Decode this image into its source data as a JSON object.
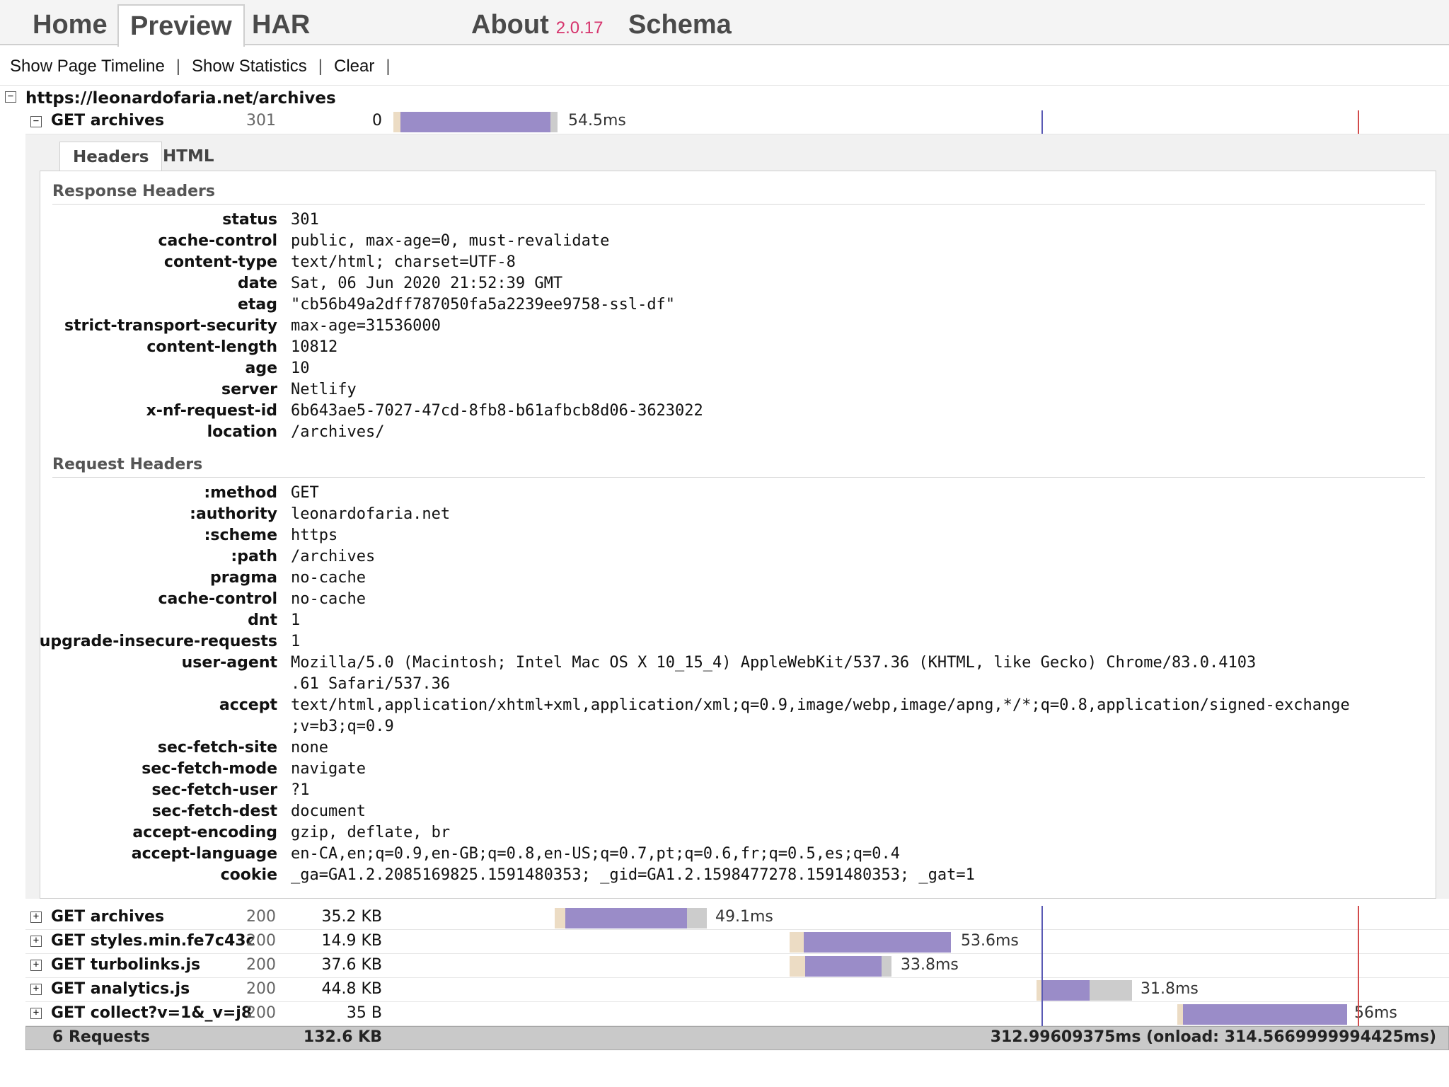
{
  "nav": {
    "home": "Home",
    "preview": "Preview",
    "har": "HAR",
    "about": "About",
    "version": "2.0.17",
    "schema": "Schema"
  },
  "toolbar": {
    "timeline": "Show Page Timeline",
    "statistics": "Show Statistics",
    "clear": "Clear",
    "sep": "|"
  },
  "page": {
    "url": "https://leonardofaria.net/archives",
    "toggle_open": "−",
    "toggle_closed": "+"
  },
  "first_entry": {
    "name": "GET archives",
    "status": "301",
    "size": "0",
    "time": "54.5ms"
  },
  "detail_tabs": {
    "headers": "Headers",
    "html": "HTML"
  },
  "response_headers": {
    "title": "Response Headers",
    "rows": [
      {
        "key": "status",
        "value": "301"
      },
      {
        "key": "cache-control",
        "value": "public, max-age=0, must-revalidate"
      },
      {
        "key": "content-type",
        "value": "text/html; charset=UTF-8"
      },
      {
        "key": "date",
        "value": "Sat, 06 Jun 2020 21:52:39 GMT"
      },
      {
        "key": "etag",
        "value": "\"cb56b49a2dff787050fa5a2239ee9758-ssl-df\""
      },
      {
        "key": "strict-transport-security",
        "value": "max-age=31536000"
      },
      {
        "key": "content-length",
        "value": "10812"
      },
      {
        "key": "age",
        "value": "10"
      },
      {
        "key": "server",
        "value": "Netlify"
      },
      {
        "key": "x-nf-request-id",
        "value": "6b643ae5-7027-47cd-8fb8-b61afbcb8d06-3623022"
      },
      {
        "key": "location",
        "value": "/archives/"
      }
    ]
  },
  "request_headers": {
    "title": "Request Headers",
    "rows": [
      {
        "key": ":method",
        "value": "GET"
      },
      {
        "key": ":authority",
        "value": "leonardofaria.net"
      },
      {
        "key": ":scheme",
        "value": "https"
      },
      {
        "key": ":path",
        "value": "/archives"
      },
      {
        "key": "pragma",
        "value": "no-cache"
      },
      {
        "key": "cache-control",
        "value": "no-cache"
      },
      {
        "key": "dnt",
        "value": "1"
      },
      {
        "key": "upgrade-insecure-requests",
        "value": "1"
      },
      {
        "key": "user-agent",
        "value": "Mozilla/5.0 (Macintosh; Intel Mac OS X 10_15_4) AppleWebKit/537.36 (KHTML, like Gecko) Chrome/83.0.4103\n.61 Safari/537.36"
      },
      {
        "key": "accept",
        "value": "text/html,application/xhtml+xml,application/xml;q=0.9,image/webp,image/apng,*/*;q=0.8,application/signed-exchange\n;v=b3;q=0.9"
      },
      {
        "key": "sec-fetch-site",
        "value": "none"
      },
      {
        "key": "sec-fetch-mode",
        "value": "navigate"
      },
      {
        "key": "sec-fetch-user",
        "value": "?1"
      },
      {
        "key": "sec-fetch-dest",
        "value": "document"
      },
      {
        "key": "accept-encoding",
        "value": "gzip, deflate, br"
      },
      {
        "key": "accept-language",
        "value": "en-CA,en;q=0.9,en-GB;q=0.8,en-US;q=0.7,pt;q=0.6,fr;q=0.5,es;q=0.4"
      },
      {
        "key": "cookie",
        "value": "_ga=GA1.2.2085169825.1591480353; _gid=GA1.2.1598477278.1591480353; _gat=1"
      }
    ]
  },
  "entries": [
    {
      "name": "GET archives",
      "status": "200",
      "size": "35.2 KB",
      "time": "49.1ms"
    },
    {
      "name": "GET styles.min.fe7c43c",
      "status": "200",
      "size": "14.9 KB",
      "time": "53.6ms"
    },
    {
      "name": "GET turbolinks.js",
      "status": "200",
      "size": "37.6 KB",
      "time": "33.8ms"
    },
    {
      "name": "GET analytics.js",
      "status": "200",
      "size": "44.8 KB",
      "time": "31.8ms"
    },
    {
      "name": "GET collect?v=1&_v=j8",
      "status": "200",
      "size": "35 B",
      "time": "56ms"
    }
  ],
  "footer": {
    "requests": "6 Requests",
    "total_size": "132.6 KB",
    "timing": "312.99609375ms (onload: 314.5669999994425ms)"
  },
  "colors": {
    "version": "#d6336c",
    "bar_receive": "#9a8cc8",
    "bar_wait": "#ecdcc4",
    "bar_post": "#cccccc",
    "dom_content_line": "#5a5ab4",
    "onload_line": "#d24b4b"
  }
}
